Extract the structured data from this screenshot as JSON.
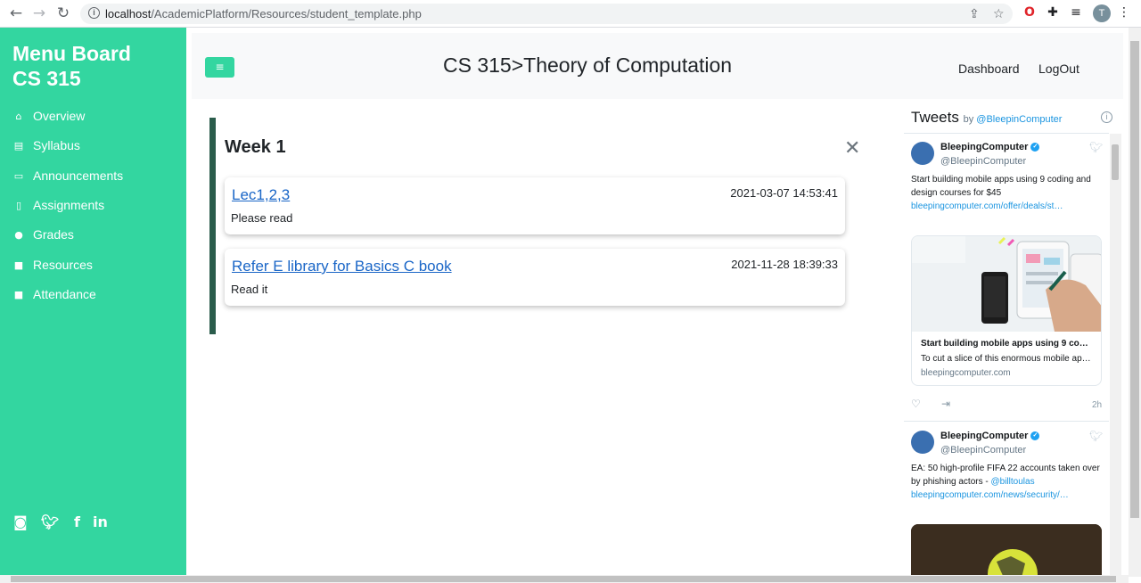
{
  "browser": {
    "url_host": "localhost",
    "url_path": "/AcademicPlatform/Resources/student_template.php",
    "avatar_letter": "T"
  },
  "sidebar": {
    "title_line1": "Menu Board",
    "title_line2": "CS 315",
    "items": [
      {
        "label": "Overview",
        "icon": "home-icon"
      },
      {
        "label": "Syllabus",
        "icon": "book-icon"
      },
      {
        "label": "Announcements",
        "icon": "chat-icon"
      },
      {
        "label": "Assignments",
        "icon": "file-icon"
      },
      {
        "label": "Grades",
        "icon": "medal-icon"
      },
      {
        "label": "Resources",
        "icon": "folder-icon"
      },
      {
        "label": "Attendance",
        "icon": "clipboard-icon"
      }
    ],
    "social": [
      "instagram-icon",
      "twitter-icon",
      "facebook-icon",
      "linkedin-icon"
    ]
  },
  "header": {
    "course_title": "CS 315>Theory of Computation",
    "links": [
      "Dashboard",
      "LogOut"
    ]
  },
  "week": {
    "title": "Week 1",
    "resources": [
      {
        "title": "Lec1,2,3",
        "date": "2021-03-07 14:53:41",
        "desc": "Please read"
      },
      {
        "title": "Refer E library for Basics C book",
        "date": "2021-11-28 18:39:33",
        "desc": "Read it"
      }
    ]
  },
  "tweets": {
    "heading": "Tweets",
    "by": "by",
    "by_handle": "@BleepinComputer",
    "items": [
      {
        "name": "BleepingComputer",
        "handle": "@BleepinComputer",
        "text": "Start building mobile apps using 9 coding and design courses for $45",
        "link": "bleepingcomputer.com/offer/deals/st…",
        "card_title": "Start building mobile apps using 9 co…",
        "card_desc": "To cut a slice of this enormous mobile ap…",
        "card_domain": "bleepingcomputer.com",
        "time": "2h"
      },
      {
        "name": "BleepingComputer",
        "handle": "@BleepinComputer",
        "text": "EA: 50 high-profile FIFA 22 accounts taken over by phishing actors - ",
        "mention": "@billtoulas",
        "link": "bleepingcomputer.com/news/security/…"
      }
    ]
  },
  "colors": {
    "accent": "#33d6a0",
    "week_border": "#2a5c4b",
    "link": "#1a66c7"
  }
}
